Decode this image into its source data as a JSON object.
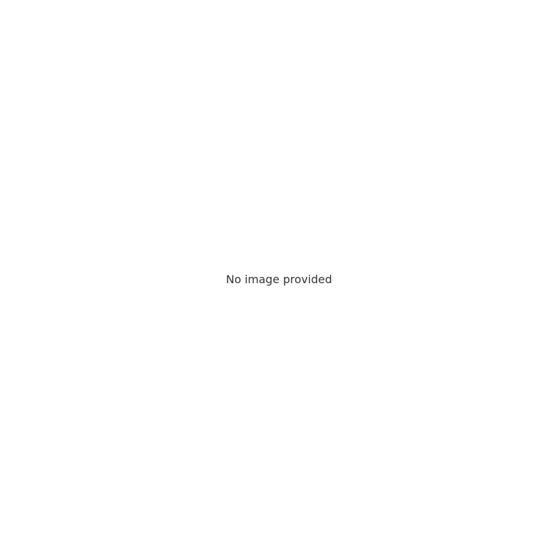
{
  "placeholder": {
    "title": "No image provided"
  }
}
